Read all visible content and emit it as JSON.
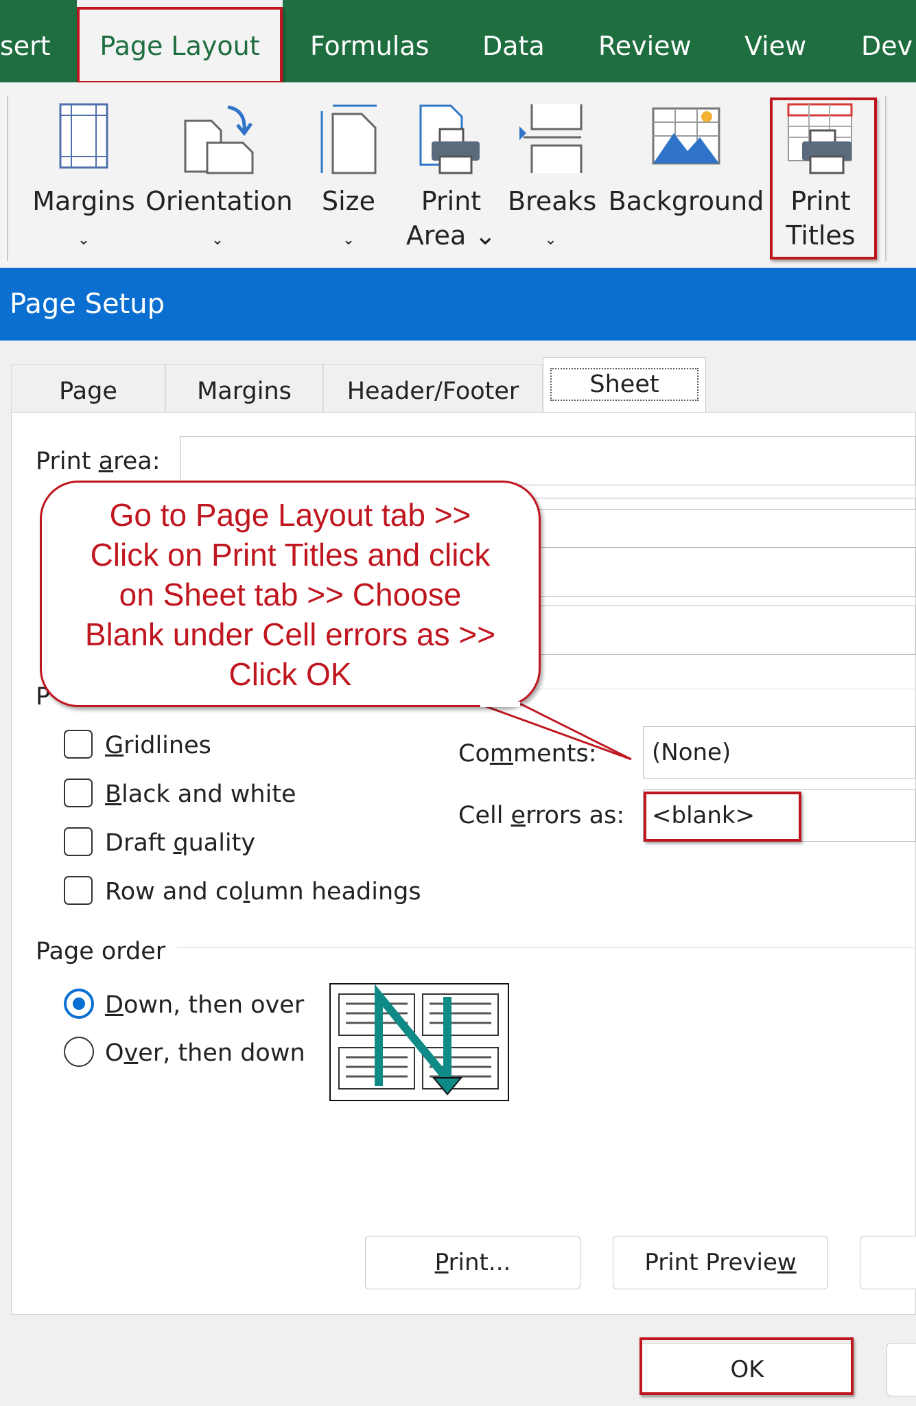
{
  "ribbon_tabs": [
    {
      "label": "sert",
      "active": false
    },
    {
      "label": "Page Layout",
      "active": true
    },
    {
      "label": "Formulas",
      "active": false
    },
    {
      "label": "Data",
      "active": false
    },
    {
      "label": "Review",
      "active": false
    },
    {
      "label": "View",
      "active": false
    },
    {
      "label": "Dev",
      "active": false
    }
  ],
  "ribbon_buttons": [
    {
      "line1": "Margins",
      "line2": "⌄",
      "icon": "margins-icon"
    },
    {
      "line1": "Orientation",
      "line2": "⌄",
      "icon": "orientation-icon"
    },
    {
      "line1": "Size",
      "line2": "⌄",
      "icon": "size-icon"
    },
    {
      "line1": "Print",
      "line2": "Area ⌄",
      "icon": "print-area-icon"
    },
    {
      "line1": "Breaks",
      "line2": "⌄",
      "icon": "breaks-icon"
    },
    {
      "line1": "Background",
      "line2": "",
      "icon": "background-icon"
    },
    {
      "line1": "Print",
      "line2": "Titles",
      "icon": "print-titles-icon"
    }
  ],
  "dialog": {
    "title": "Page Setup",
    "tabs": [
      "Page",
      "Margins",
      "Header/Footer",
      "Sheet"
    ],
    "selected_tab": "Sheet",
    "print_area_label_pre": "Print ",
    "print_area_label_u": "a",
    "print_area_label_post": "rea:",
    "comments_label_pre": "Co",
    "comments_label_u": "m",
    "comments_label_post": "ments:",
    "comments_value": "(None)",
    "cell_errors_label_pre": "Cell ",
    "cell_errors_label_u": "e",
    "cell_errors_label_post": "rrors as:",
    "cell_errors_value": "<blank>",
    "print_section_fragment": "P",
    "checkboxes": [
      {
        "pre": "",
        "u": "G",
        "post": "ridlines",
        "checked": false
      },
      {
        "pre": "",
        "u": "B",
        "post": "lack and white",
        "checked": false
      },
      {
        "pre": "Draft ",
        "u": "q",
        "post": "uality",
        "checked": false
      },
      {
        "pre": "Row and co",
        "u": "l",
        "post": "umn headings",
        "checked": false
      }
    ],
    "page_order_label": "Page order",
    "page_order_options": [
      {
        "pre": "",
        "u": "D",
        "post": "own, then over",
        "selected": true
      },
      {
        "pre": "O",
        "u": "v",
        "post": "er, then down",
        "selected": false
      }
    ],
    "buttons": {
      "print_pre": "",
      "print_u": "P",
      "print_post": "rint...",
      "preview_pre": "Print Previe",
      "preview_u": "w",
      "preview_post": "",
      "ok": "OK"
    }
  },
  "callout": {
    "lines": [
      "Go to Page Layout tab >>",
      "Click on Print Titles and click",
      "on Sheet tab >> Choose",
      "Blank under Cell errors as >>",
      "Click OK"
    ]
  },
  "colors": {
    "excel_green": "#1e6e3f",
    "dialog_blue": "#0a6fd0",
    "highlight_red": "#c0161f",
    "page_order_arrow": "#0f8a86"
  }
}
